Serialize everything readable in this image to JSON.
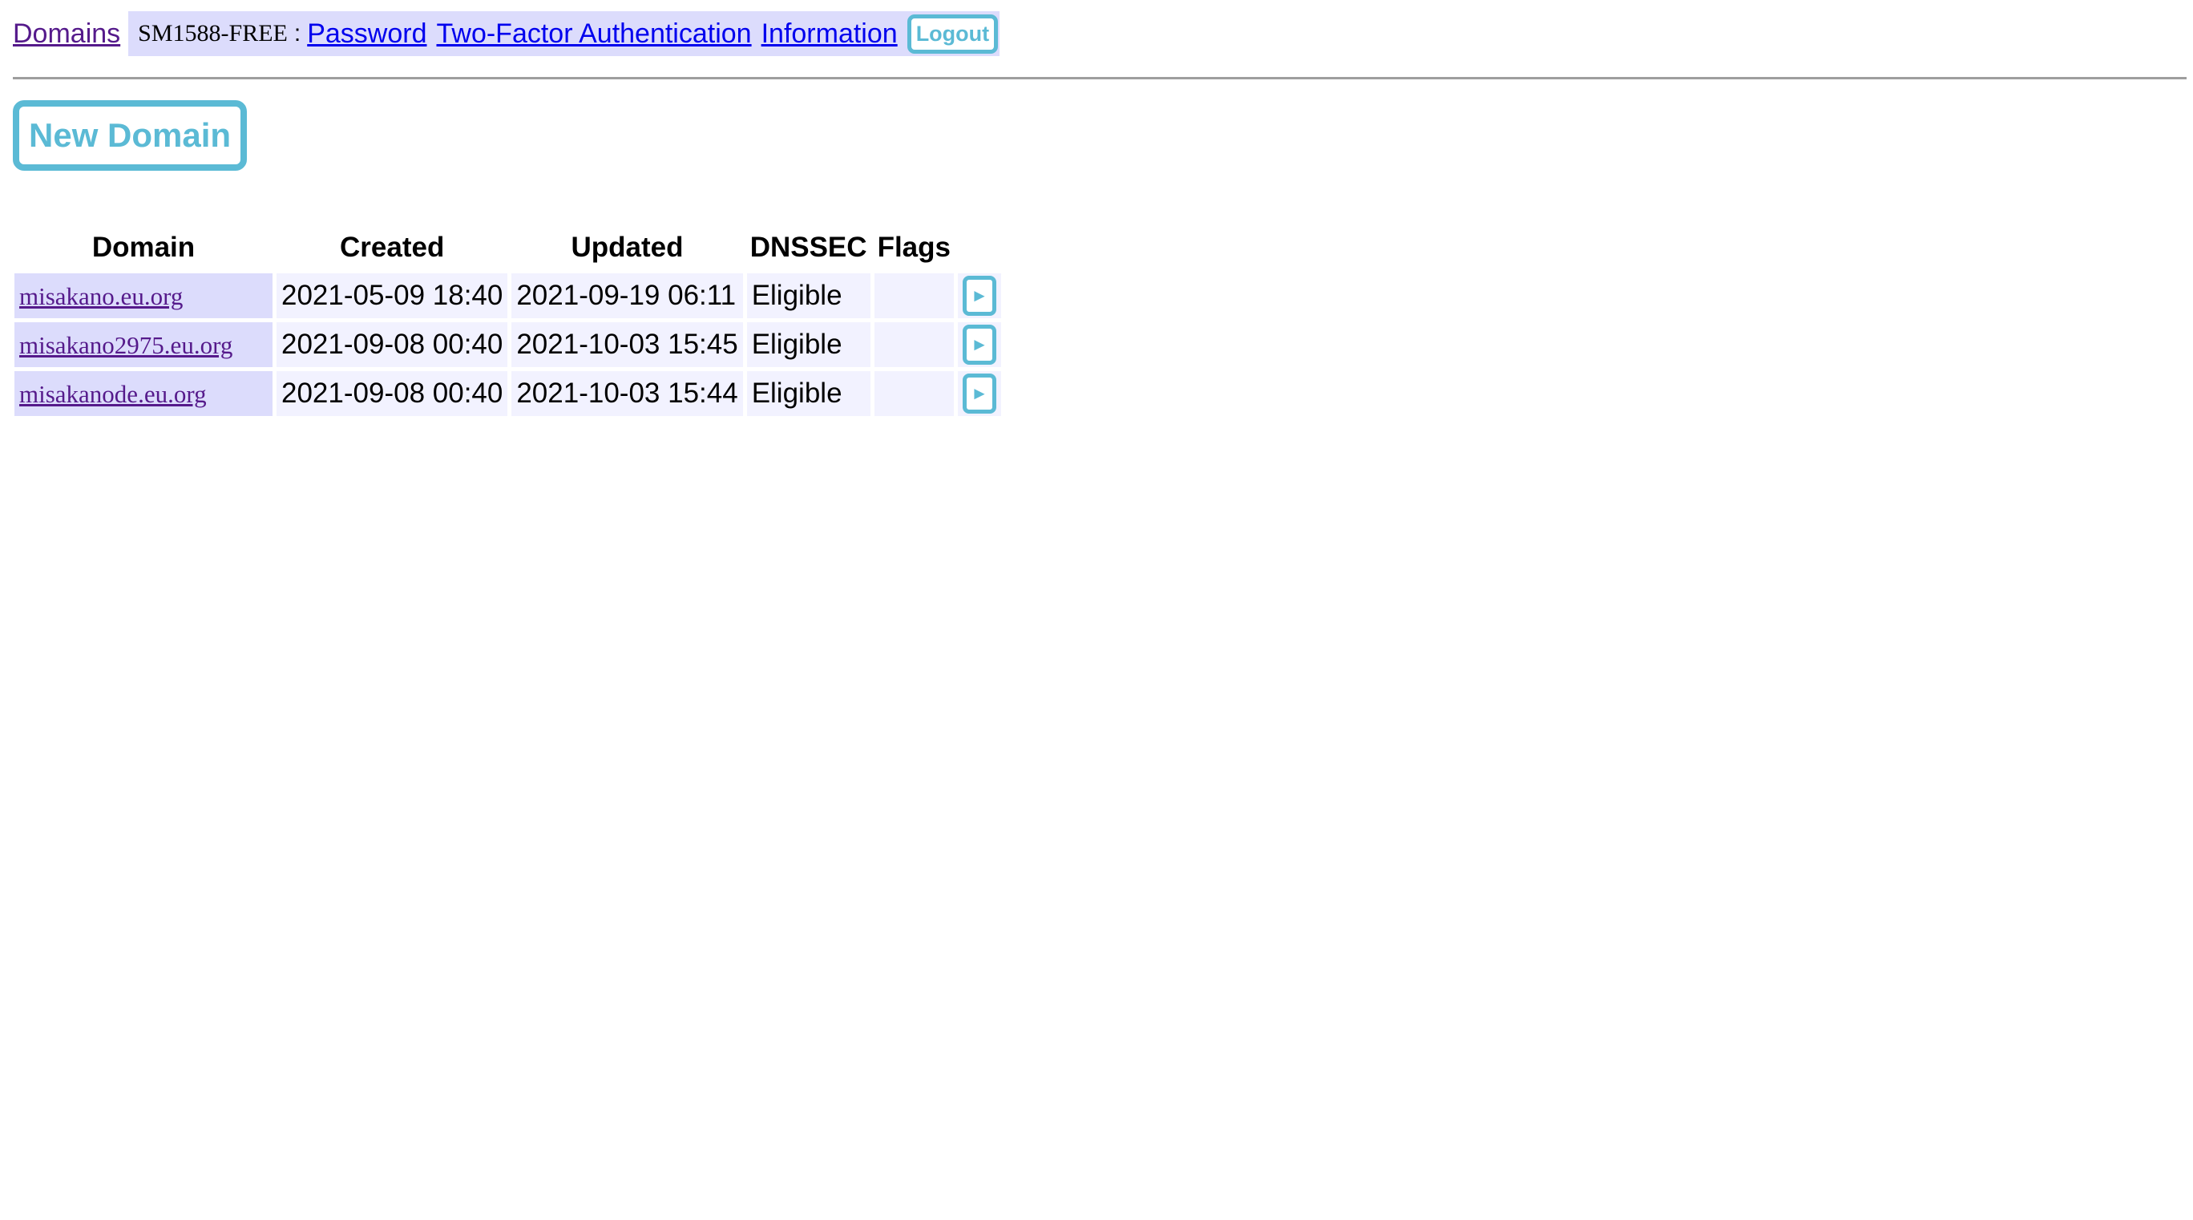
{
  "nav": {
    "domains_link": "Domains",
    "user_handle": "SM1588-FREE",
    "separator": ":",
    "password_link": "Password",
    "two_factor_link": "Two-Factor Authentication",
    "information_link": "Information",
    "logout_label": "Logout"
  },
  "actions": {
    "new_domain_label": "New Domain"
  },
  "table": {
    "headers": [
      "Domain",
      "Created",
      "Updated",
      "DNSSEC",
      "Flags"
    ],
    "rows": [
      {
        "domain": "misakano.eu.org",
        "created": "2021-05-09 18:40",
        "updated": "2021-09-19 06:11",
        "dnssec": "Eligible",
        "flags": "",
        "action_icon": "►"
      },
      {
        "domain": "misakano2975.eu.org",
        "created": "2021-09-08 00:40",
        "updated": "2021-10-03 15:45",
        "dnssec": "Eligible",
        "flags": "",
        "action_icon": "►"
      },
      {
        "domain": "misakanode.eu.org",
        "created": "2021-09-08 00:40",
        "updated": "2021-10-03 15:44",
        "dnssec": "Eligible",
        "flags": "",
        "action_icon": "►"
      }
    ]
  },
  "colors": {
    "accent": "#5bbad5",
    "user_box_bg": "#dcdcfc",
    "cell_bg": "#f2f2ff",
    "visited_link": "#551a8b",
    "link": "#0000ee"
  },
  "icons": {
    "row_action": "arrow-right-icon"
  }
}
